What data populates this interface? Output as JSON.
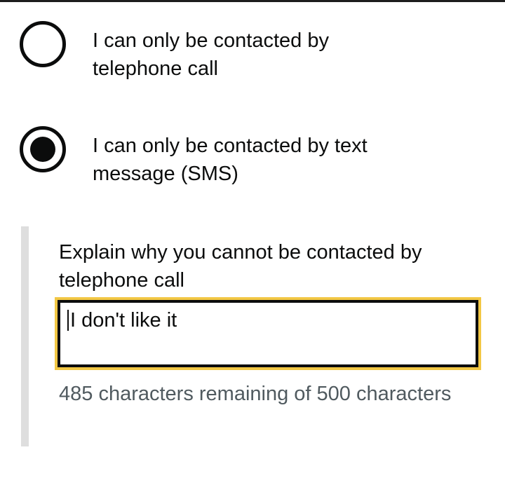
{
  "radios": [
    {
      "label": "I can only be contacted by telephone call",
      "checked": false
    },
    {
      "label": "I can only be contacted by text message (SMS)",
      "checked": true
    }
  ],
  "conditional": {
    "label": "Explain why you cannot be contacted by telephone call",
    "textarea_value": "I don't like it",
    "character_count_hint": "485 characters remaining of 500 characters",
    "focus_color": "#f2c744"
  }
}
